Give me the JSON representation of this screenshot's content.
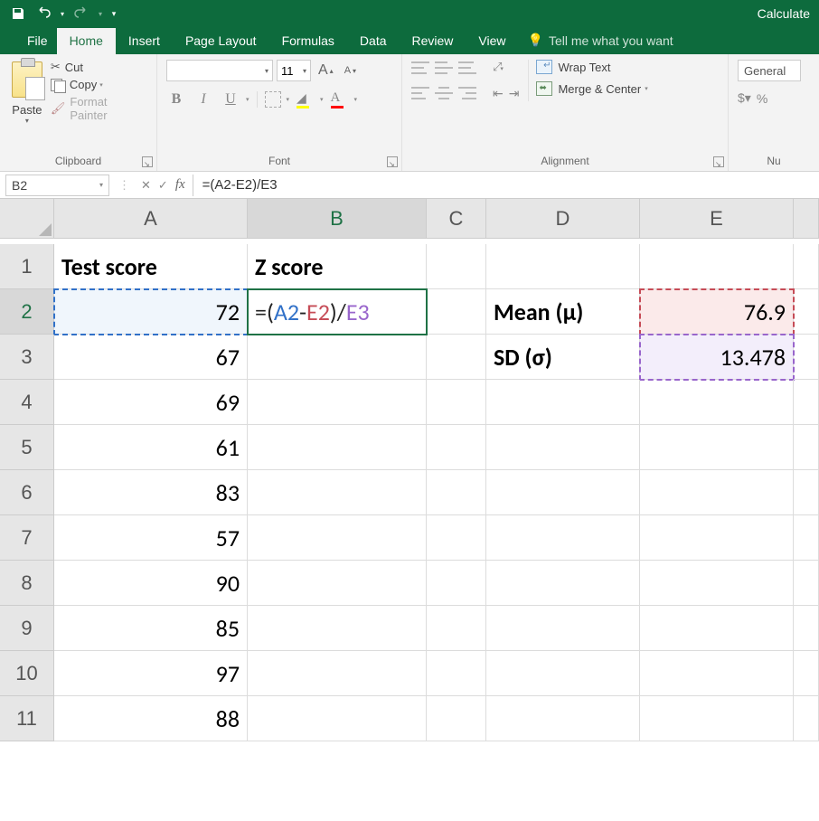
{
  "titlebar": {
    "right_text": "Calculate"
  },
  "tabs": {
    "file": "File",
    "home": "Home",
    "insert": "Insert",
    "page_layout": "Page Layout",
    "formulas": "Formulas",
    "data": "Data",
    "review": "Review",
    "view": "View",
    "tell_me": "Tell me what you want"
  },
  "ribbon": {
    "clipboard": {
      "paste": "Paste",
      "cut": "Cut",
      "copy": "Copy",
      "format_painter": "Format Painter",
      "label": "Clipboard"
    },
    "font": {
      "font_name": "",
      "font_size": "11",
      "label": "Font"
    },
    "alignment": {
      "wrap": "Wrap Text",
      "merge": "Merge & Center",
      "label": "Alignment"
    },
    "number": {
      "format": "General",
      "label": "Nu"
    }
  },
  "namebox": "B2",
  "formula_bar": "=(A2-E2)/E3",
  "formula_parts": {
    "pre": "=(",
    "a2": "A2",
    "dash": "-",
    "e2": "E2",
    "mid": ")/",
    "e3": "E3"
  },
  "columns": [
    "A",
    "B",
    "C",
    "D",
    "E"
  ],
  "rows": [
    "1",
    "2",
    "3",
    "4",
    "5",
    "6",
    "7",
    "8",
    "9",
    "10",
    "11"
  ],
  "cells": {
    "A1": "Test score",
    "B1": "Z score",
    "A2": "72",
    "A3": "67",
    "A4": "69",
    "A5": "61",
    "A6": "83",
    "A7": "57",
    "A8": "90",
    "A9": "85",
    "A10": "97",
    "A11": "88",
    "D2": "Mean (μ)",
    "D3": "SD (σ)",
    "E2": "76.9",
    "E3": "13.478"
  },
  "chart_data": {
    "type": "table",
    "title": "Test score and Z score",
    "columns": [
      "Test score",
      "Z score"
    ],
    "rows": [
      [
        72,
        null
      ],
      [
        67,
        null
      ],
      [
        69,
        null
      ],
      [
        61,
        null
      ],
      [
        83,
        null
      ],
      [
        57,
        null
      ],
      [
        90,
        null
      ],
      [
        85,
        null
      ],
      [
        97,
        null
      ],
      [
        88,
        null
      ]
    ],
    "stats": {
      "Mean (μ)": 76.9,
      "SD (σ)": 13.478
    },
    "formula_B2": "=(A2-E2)/E3"
  }
}
